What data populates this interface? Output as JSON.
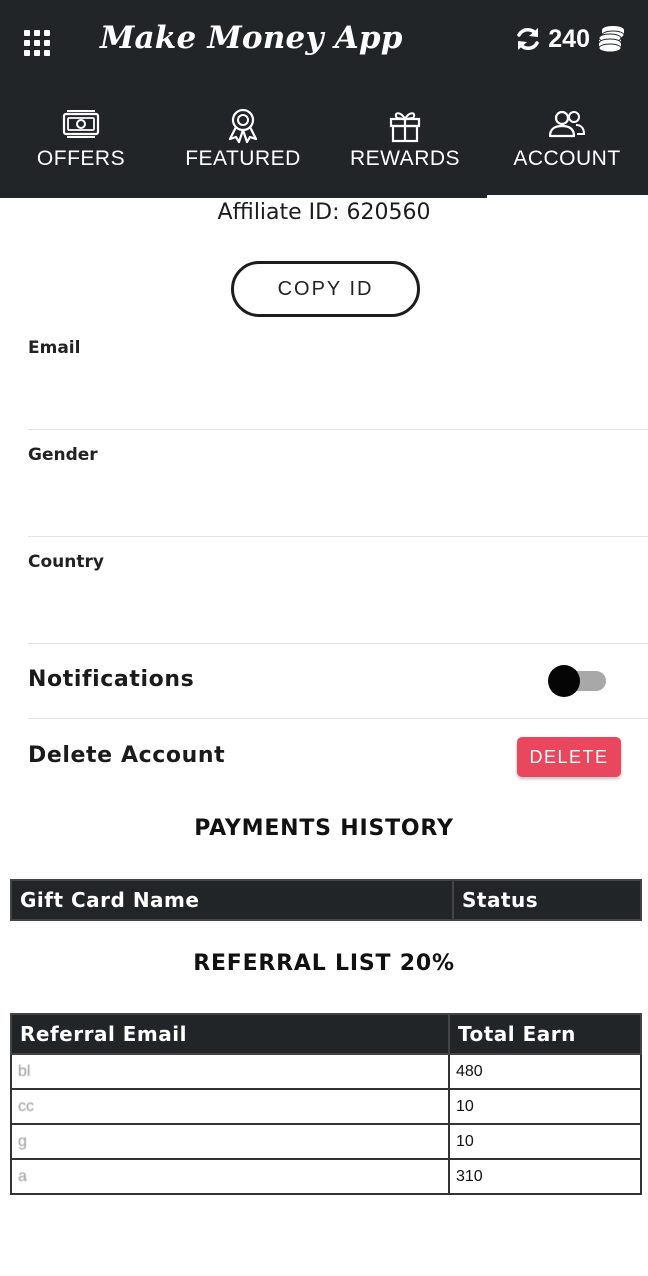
{
  "app": {
    "title": "Make Money App",
    "coins": "240"
  },
  "tabs": [
    {
      "label": "OFFERS",
      "icon": "banknote-icon"
    },
    {
      "label": "FEATURED",
      "icon": "award-ribbon-icon"
    },
    {
      "label": "REWARDS",
      "icon": "gift-icon"
    },
    {
      "label": "ACCOUNT",
      "icon": "users-icon",
      "active": true
    }
  ],
  "account": {
    "affiliate_id": "Affiliate ID: 620560",
    "copy_label": "COPY ID",
    "email_label": "Email",
    "email_value": "",
    "gender_label": "Gender",
    "gender_value": "",
    "country_label": "Country",
    "country_value": "",
    "notifications_label": "Notifications",
    "delete_account_label": "Delete Account",
    "delete_button": "DELETE"
  },
  "payments": {
    "title": "PAYMENTS HISTORY",
    "headers": [
      "Gift Card Name",
      "Status"
    ]
  },
  "referrals": {
    "title": "REFERRAL LIST 20%",
    "headers": [
      "Referral Email",
      "Total Earn"
    ],
    "rows": [
      {
        "email": "bl",
        "earn": "480"
      },
      {
        "email": "cc",
        "earn": "10"
      },
      {
        "email": "g",
        "earn": "10"
      },
      {
        "email": "a",
        "earn": "310"
      }
    ]
  },
  "colors": {
    "header_bg": "#222528",
    "delete": "#e8475d",
    "toggle_track": "#a8a8a8"
  }
}
